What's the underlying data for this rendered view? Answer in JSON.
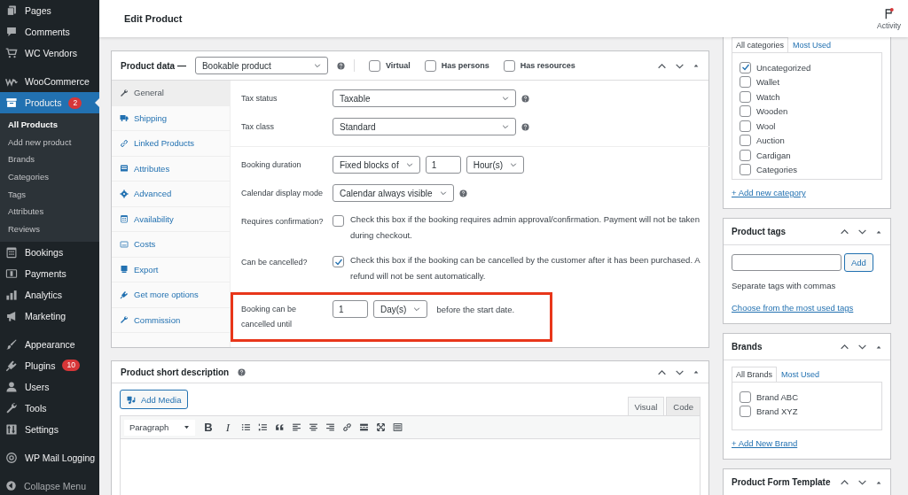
{
  "sidebar": {
    "groups": [
      {
        "items": [
          {
            "label": "Pages",
            "selected": false
          },
          {
            "label": "Comments",
            "selected": false
          },
          {
            "label": "WC Vendors",
            "selected": false
          }
        ]
      },
      {
        "items": [
          {
            "label": "WooCommerce",
            "selected": false
          },
          {
            "label": "Products",
            "badge": "2",
            "selected": true,
            "submenu": [
              {
                "label": "All Products",
                "selected": true
              },
              {
                "label": "Add new product",
                "selected": false
              },
              {
                "label": "Brands",
                "selected": false
              },
              {
                "label": "Categories",
                "selected": false
              },
              {
                "label": "Tags",
                "selected": false
              },
              {
                "label": "Attributes",
                "selected": false
              },
              {
                "label": "Reviews",
                "selected": false
              }
            ]
          },
          {
            "label": "Bookings",
            "selected": false
          },
          {
            "label": "Payments",
            "selected": false
          },
          {
            "label": "Analytics",
            "selected": false
          },
          {
            "label": "Marketing",
            "selected": false
          }
        ]
      },
      {
        "items": [
          {
            "label": "Appearance",
            "selected": false
          },
          {
            "label": "Plugins",
            "badge": "10",
            "selected": false
          },
          {
            "label": "Users",
            "selected": false
          },
          {
            "label": "Tools",
            "selected": false
          },
          {
            "label": "Settings",
            "selected": false
          }
        ]
      },
      {
        "items": [
          {
            "label": "WP Mail Logging",
            "selected": false
          }
        ]
      }
    ],
    "collapse_button": "Collapse Menu"
  },
  "header": {
    "title": "Edit Product",
    "activity": {
      "label": "Activity",
      "notification": true
    }
  },
  "product_data": {
    "title": "Product data —",
    "product_type": "Bookable product",
    "options": [
      {
        "label": "Virtual",
        "checked": false
      },
      {
        "label": "Has persons",
        "checked": false
      },
      {
        "label": "Has resources",
        "checked": false
      }
    ],
    "tabs": [
      {
        "label": "General",
        "selected": true
      },
      {
        "label": "Shipping",
        "selected": false
      },
      {
        "label": "Linked Products",
        "selected": false
      },
      {
        "label": "Attributes",
        "selected": false
      },
      {
        "label": "Advanced",
        "selected": false
      },
      {
        "label": "Availability",
        "selected": false
      },
      {
        "label": "Costs",
        "selected": false
      },
      {
        "label": "Export",
        "selected": false
      },
      {
        "label": "Get more options",
        "selected": false
      },
      {
        "label": "Commission",
        "selected": false
      }
    ],
    "sections": [
      {
        "fields": [
          {
            "label": "Tax status",
            "highlighted": false,
            "controls": [
              {
                "kind": "select",
                "value": "Taxable"
              },
              {
                "kind": "help"
              }
            ]
          },
          {
            "label": "Tax class",
            "highlighted": false,
            "controls": [
              {
                "kind": "select",
                "value": "Standard"
              },
              {
                "kind": "help"
              }
            ]
          }
        ]
      },
      {
        "fields": [
          {
            "label": "Booking duration",
            "highlighted": false,
            "controls": [
              {
                "kind": "select",
                "value": "Fixed blocks of"
              },
              {
                "kind": "input",
                "value": "1"
              },
              {
                "kind": "select",
                "value": "Hour(s)"
              }
            ]
          },
          {
            "label": "Calendar display mode",
            "highlighted": false,
            "controls": [
              {
                "kind": "select",
                "value": "Calendar always visible"
              },
              {
                "kind": "help"
              }
            ]
          },
          {
            "label": "Requires confirmation?",
            "highlighted": false,
            "controls": [
              {
                "kind": "checkbox",
                "checked": false,
                "text": "Check this box if the booking requires admin approval/confirmation. Payment will not be taken during checkout."
              }
            ]
          },
          {
            "label": "Can be cancelled?",
            "highlighted": false,
            "controls": [
              {
                "kind": "checkbox",
                "checked": true,
                "text": "Check this box if the booking can be cancelled by the customer after it has been purchased. A refund will not be sent automatically."
              }
            ]
          },
          {
            "label": "Booking can be cancelled until",
            "highlighted": true,
            "controls": [
              {
                "kind": "input",
                "value": "1"
              },
              {
                "kind": "select",
                "value": "Day(s)"
              },
              {
                "kind": "text",
                "text": "before the start date."
              }
            ]
          }
        ]
      }
    ]
  },
  "short_description": {
    "title": "Product short description",
    "add_media": "Add Media",
    "editor_tabs": [
      {
        "label": "Visual",
        "selected": true
      },
      {
        "label": "Code",
        "selected": false
      }
    ],
    "format": "Paragraph",
    "letter_buttons": [
      {
        "label": "B",
        "kind": "bold"
      },
      {
        "label": "I",
        "kind": "italic"
      }
    ]
  },
  "categories": {
    "tabs": [
      {
        "label": "All categories",
        "selected": true
      },
      {
        "label": "Most Used",
        "selected": false
      }
    ],
    "items": [
      {
        "label": "Uncategorized",
        "checked": true
      },
      {
        "label": "Wallet",
        "checked": false
      },
      {
        "label": "Watch",
        "checked": false
      },
      {
        "label": "Wooden",
        "checked": false
      },
      {
        "label": "Wool",
        "checked": false
      },
      {
        "label": "Auction",
        "checked": false
      },
      {
        "label": "Cardigan",
        "checked": false
      },
      {
        "label": "Categories",
        "checked": false
      }
    ],
    "add_link": "+ Add new category"
  },
  "product_tags": {
    "title": "Product tags",
    "add_button": "Add",
    "hint": "Separate tags with commas",
    "link": "Choose from the most used tags"
  },
  "brands": {
    "title": "Brands",
    "tabs": [
      {
        "label": "All Brands",
        "selected": true
      },
      {
        "label": "Most Used",
        "selected": false
      }
    ],
    "items": [
      {
        "label": "Brand ABC",
        "checked": false
      },
      {
        "label": "Brand XYZ",
        "checked": false
      }
    ],
    "add_link": "+ Add New Brand"
  },
  "form_template": {
    "title": "Product Form Template"
  }
}
